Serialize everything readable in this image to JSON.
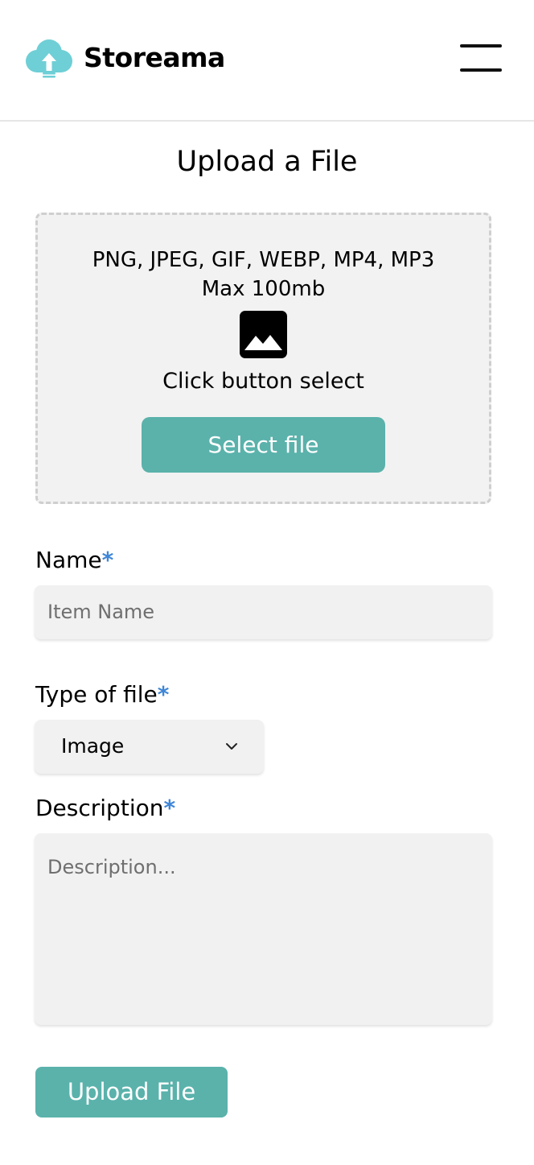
{
  "header": {
    "brand": "Storeama",
    "logo_icon": "cloud-upload-icon",
    "menu_icon": "hamburger-menu-icon"
  },
  "page": {
    "title": "Upload a File"
  },
  "dropzone": {
    "formats": "PNG, JPEG, GIF, WEBP, MP4, MP3",
    "max_size": "Max 100mb",
    "icon": "image-icon",
    "hint": "Click button select",
    "select_button_label": "Select file"
  },
  "form": {
    "name": {
      "label": "Name",
      "required_mark": "*",
      "placeholder": "Item Name",
      "value": ""
    },
    "file_type": {
      "label": "Type of file",
      "required_mark": "*",
      "selected": "Image"
    },
    "description": {
      "label": "Description",
      "required_mark": "*",
      "placeholder": "Description...",
      "value": ""
    },
    "submit_label": "Upload File"
  },
  "colors": {
    "accent": "#5ab2ab",
    "required_mark": "#3f86d6",
    "logo": "#6fcfd6",
    "field_background": "#f1f1f1"
  }
}
